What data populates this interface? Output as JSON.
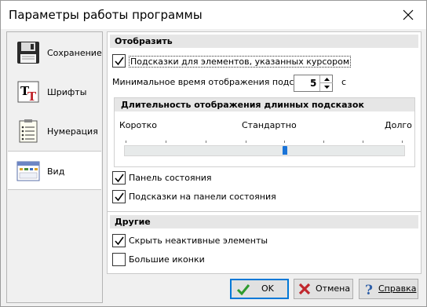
{
  "window": {
    "title": "Параметры работы программы"
  },
  "sidebar": {
    "items": [
      {
        "label": "Сохранение",
        "icon": "floppy-disk-icon",
        "active": false
      },
      {
        "label": "Шрифты",
        "icon": "font-icon",
        "active": false
      },
      {
        "label": "Нумерация",
        "icon": "numbered-list-icon",
        "active": false
      },
      {
        "label": "Вид",
        "icon": "window-view-icon",
        "active": true
      }
    ]
  },
  "display": {
    "header": "Отобразить",
    "cursor_hints": {
      "label": "Подсказки для элементов, указанных курсором",
      "checked": true
    },
    "min_time": {
      "label": "Минимальное время отображения подсказки",
      "value": "5",
      "unit": "с"
    },
    "long_hints": {
      "header": "Длительность отображения длинных подсказок",
      "left": "Коротко",
      "center": "Стандартно",
      "right": "Долго",
      "slider_position": 0.57
    },
    "status_bar": {
      "label": "Панель состояния",
      "checked": true
    },
    "status_hints": {
      "label": "Подсказки на панели состояния",
      "checked": true
    }
  },
  "other": {
    "header": "Другие",
    "hide_inactive": {
      "label": "Скрыть неактивные элементы",
      "checked": true
    },
    "large_icons": {
      "label": "Большие иконки",
      "checked": false
    }
  },
  "buttons": {
    "ok": "OK",
    "cancel": "Отмена",
    "help": "Справка"
  },
  "colors": {
    "accent": "#0078d7",
    "slider": "#1a74d8",
    "ok_check": "#2e9b2e",
    "cancel_x": "#c0272d"
  }
}
